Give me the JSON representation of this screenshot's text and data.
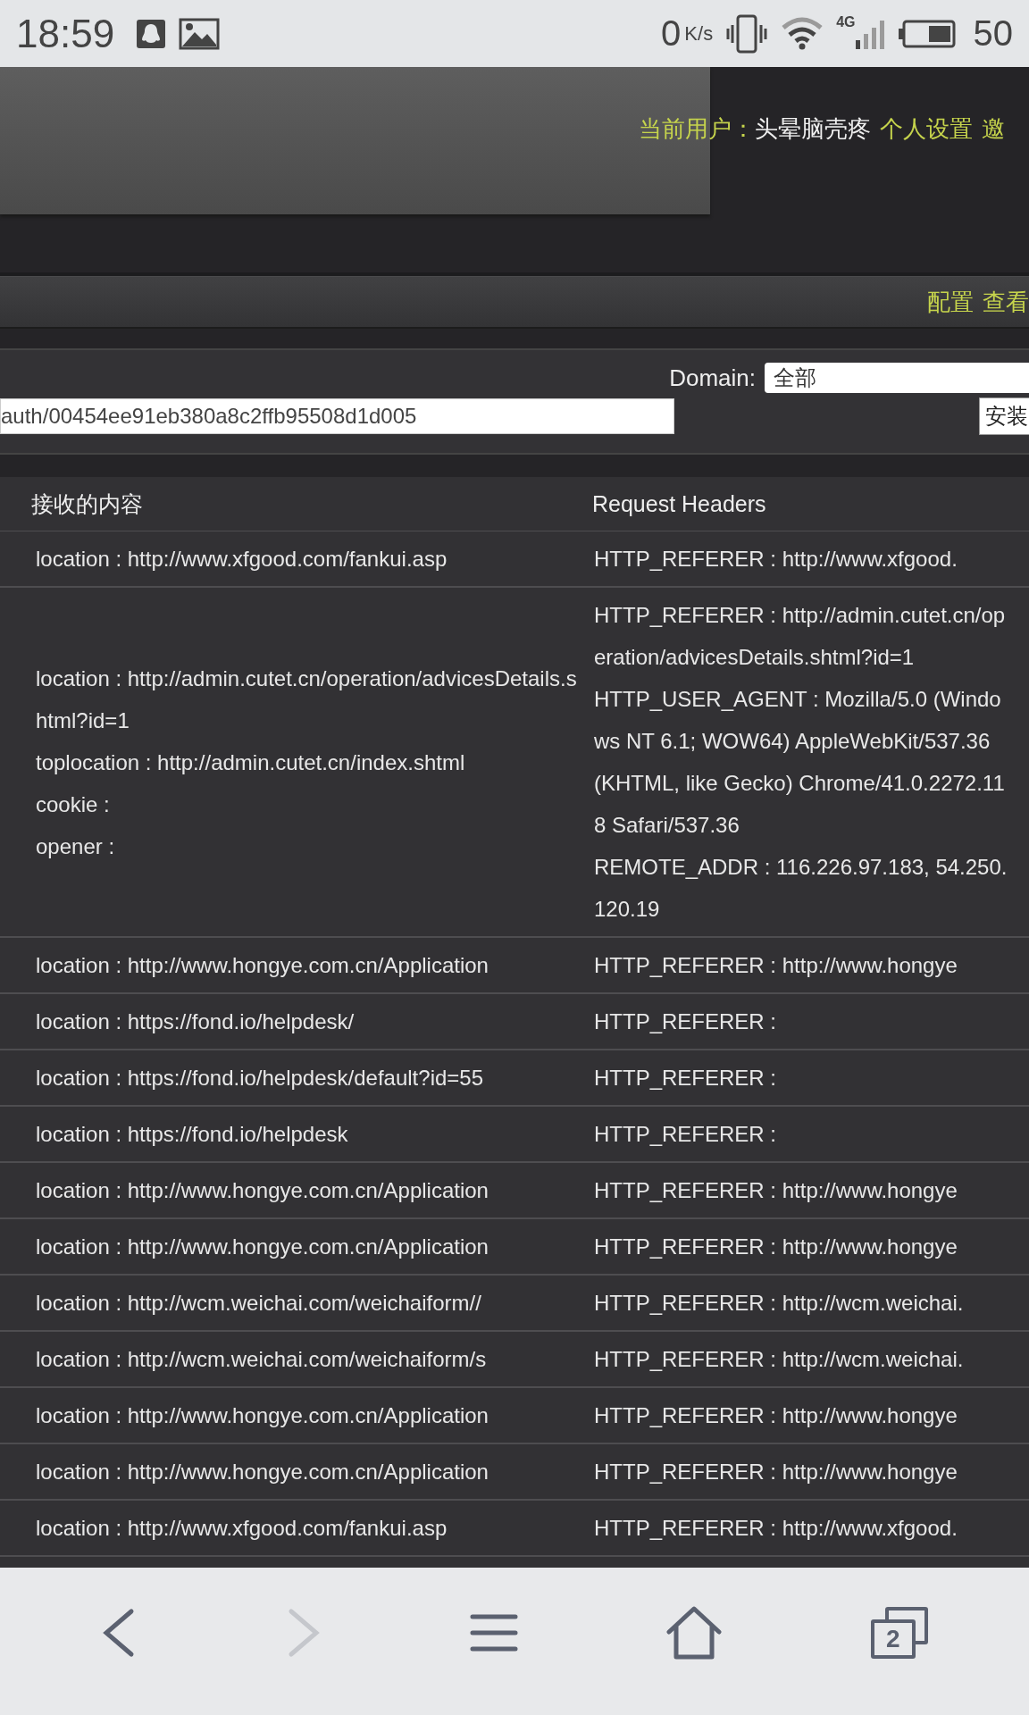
{
  "status_bar": {
    "time": "18:59",
    "speed_value": "0",
    "speed_unit": "K/s",
    "network": "4G",
    "battery": "50"
  },
  "header": {
    "user_label": "当前用户：",
    "username": "头晕脑壳疼",
    "links": [
      "个人设置",
      "邀"
    ]
  },
  "nav": {
    "links": [
      "配置",
      "查看"
    ]
  },
  "filter": {
    "domain_label": "Domain:",
    "domain_value": "全部",
    "url_value": "auth/00454ee91eb380a8c2ffb95508d1d005",
    "install_button": "安装"
  },
  "table": {
    "columns": [
      "接收的内容",
      "Request Headers"
    ],
    "rows": [
      {
        "received": [
          "location : http://www.xfgood.com/fankui.asp"
        ],
        "headers": [
          "HTTP_REFERER : http://www.xfgood."
        ]
      },
      {
        "received": [
          "location : http://admin.cutet.cn/operation/advicesDetails.shtml?id=1",
          "toplocation : http://admin.cutet.cn/index.shtml",
          "cookie :",
          "opener :"
        ],
        "headers": [
          "HTTP_REFERER : http://admin.cutet.cn/operation/advicesDetails.shtml?id=1",
          "HTTP_USER_AGENT : Mozilla/5.0 (Windows NT 6.1; WOW64) AppleWebKit/537.36 (KHTML, like Gecko) Chrome/41.0.2272.118 Safari/537.36",
          "REMOTE_ADDR : 116.226.97.183, 54.250.120.19"
        ]
      },
      {
        "received": [
          "location : http://www.hongye.com.cn/Application"
        ],
        "headers": [
          "HTTP_REFERER : http://www.hongye"
        ]
      },
      {
        "received": [
          "location : https://fond.io/helpdesk/"
        ],
        "headers": [
          "HTTP_REFERER :"
        ]
      },
      {
        "received": [
          "location : https://fond.io/helpdesk/default?id=55"
        ],
        "headers": [
          "HTTP_REFERER :"
        ]
      },
      {
        "received": [
          "location : https://fond.io/helpdesk"
        ],
        "headers": [
          "HTTP_REFERER :"
        ]
      },
      {
        "received": [
          "location : http://www.hongye.com.cn/Application"
        ],
        "headers": [
          "HTTP_REFERER : http://www.hongye"
        ]
      },
      {
        "received": [
          "location : http://www.hongye.com.cn/Application"
        ],
        "headers": [
          "HTTP_REFERER : http://www.hongye"
        ]
      },
      {
        "received": [
          "location : http://wcm.weichai.com/weichaiform//"
        ],
        "headers": [
          "HTTP_REFERER : http://wcm.weichai."
        ]
      },
      {
        "received": [
          "location : http://wcm.weichai.com/weichaiform/s"
        ],
        "headers": [
          "HTTP_REFERER : http://wcm.weichai."
        ]
      },
      {
        "received": [
          "location : http://www.hongye.com.cn/Application"
        ],
        "headers": [
          "HTTP_REFERER : http://www.hongye"
        ]
      },
      {
        "received": [
          "location : http://www.hongye.com.cn/Application"
        ],
        "headers": [
          "HTTP_REFERER : http://www.hongye"
        ]
      },
      {
        "received": [
          "location : http://www.xfgood.com/fankui.asp"
        ],
        "headers": [
          "HTTP_REFERER : http://www.xfgood."
        ]
      }
    ]
  },
  "bottom_bar": {
    "items": [
      {
        "kind": "back",
        "disabled": false
      },
      {
        "kind": "forward",
        "disabled": true
      },
      {
        "kind": "menu",
        "disabled": false
      },
      {
        "kind": "home",
        "disabled": false
      },
      {
        "kind": "tabs",
        "disabled": false,
        "count": "2"
      }
    ]
  }
}
